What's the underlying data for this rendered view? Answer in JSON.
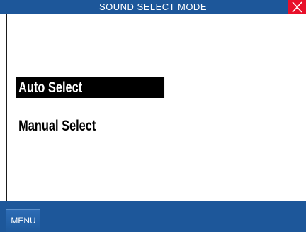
{
  "window": {
    "title": "SOUND SELECT MODE"
  },
  "icons": {
    "close": "close-icon"
  },
  "colors": {
    "bar_blue": "#1d579a",
    "close_red": "#e8102a",
    "selection_bg": "#000000",
    "selection_fg": "#ffffff"
  },
  "options": [
    {
      "label": "Auto Select",
      "selected": true
    },
    {
      "label": "Manual Select",
      "selected": false
    }
  ],
  "bottom": {
    "menu_label": "MENU"
  }
}
